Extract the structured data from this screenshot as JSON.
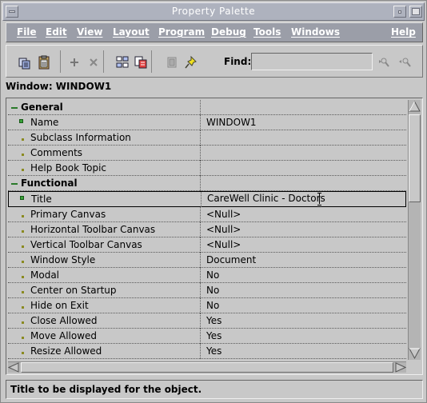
{
  "window": {
    "title": "Property Palette"
  },
  "menubar": {
    "items": [
      {
        "label": "File"
      },
      {
        "label": "Edit"
      },
      {
        "label": "View"
      },
      {
        "label": "Layout"
      },
      {
        "label": "Program"
      },
      {
        "label": "Debug"
      },
      {
        "label": "Tools"
      },
      {
        "label": "Windows"
      },
      {
        "label": "Help"
      }
    ]
  },
  "toolbar": {
    "icons": [
      "copy-properties-icon",
      "paste-properties-icon",
      "add-property-icon",
      "delete-property-icon",
      "intersection-icon",
      "union-icon",
      "inherit-icon",
      "freeze-pin-icon",
      "find-forward-icon",
      "find-backward-icon"
    ],
    "find_label": "Find:",
    "find_value": ""
  },
  "object_label": "Window: WINDOW1",
  "properties": {
    "general_label": "General",
    "name_label": "Name",
    "name_value": "WINDOW1",
    "subclass_label": "Subclass Information",
    "comments_label": "Comments",
    "helpbook_label": "Help Book Topic",
    "functional_label": "Functional",
    "title_label": "Title",
    "title_value": "CareWell Clinic - Doctors",
    "primary_canvas_label": "Primary Canvas",
    "primary_canvas_value": "<Null>",
    "htoolbar_label": "Horizontal Toolbar Canvas",
    "htoolbar_value": "<Null>",
    "vtoolbar_label": "Vertical Toolbar Canvas",
    "vtoolbar_value": "<Null>",
    "window_style_label": "Window Style",
    "window_style_value": "Document",
    "modal_label": "Modal",
    "modal_value": "No",
    "center_label": "Center on Startup",
    "center_value": "No",
    "hide_label": "Hide on Exit",
    "hide_value": "No",
    "close_label": "Close Allowed",
    "close_value": "Yes",
    "move_label": "Move Allowed",
    "move_value": "Yes",
    "resize_label": "Resize Allowed",
    "resize_value": "Yes"
  },
  "status_text": "Title to be displayed for the object.",
  "colors": {
    "title_bar": "#aeb2be",
    "menu_bar": "#9b9ea8",
    "background": "#c8c8c8",
    "category_marker": "#2a7a2a",
    "property_marker": "#3aa23a"
  }
}
